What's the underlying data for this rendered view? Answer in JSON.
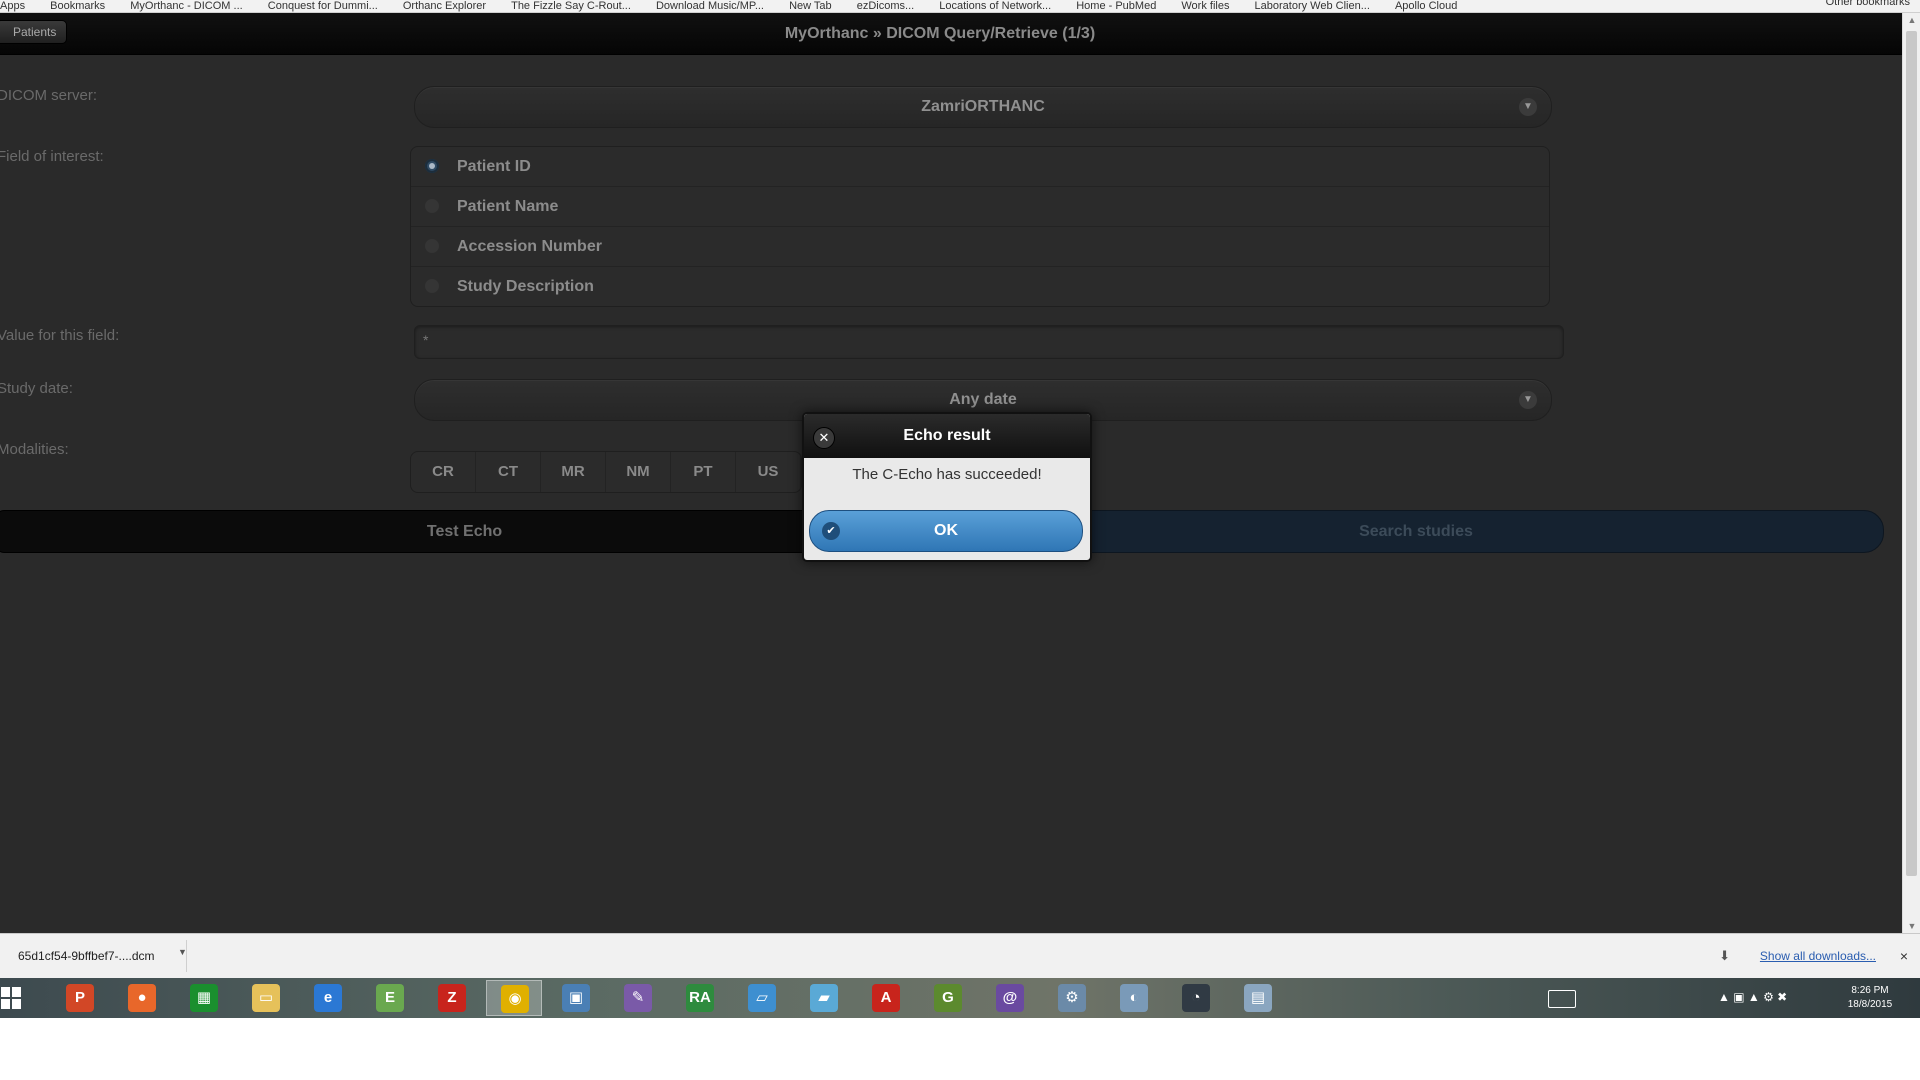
{
  "bookmarks": [
    "Apps",
    "Bookmarks",
    "MyOrthanc - DICOM ...",
    "Conquest for Dummi...",
    "Orthanc Explorer",
    "The Fizzle Say C-Rout...",
    "Download Music/MP...",
    "New Tab",
    "ezDicoms...",
    "Locations of Network...",
    "Home - PubMed",
    "Work files",
    "Laboratory Web Clien...",
    "Apollo Cloud"
  ],
  "bookmarks_other": "Other bookmarks",
  "header": {
    "back_label": "Patients",
    "title": "MyOrthanc » DICOM Query/Retrieve (1/3)"
  },
  "form": {
    "server_label": "DICOM server:",
    "server_value": "ZamriORTHANC",
    "field_label": "Field of interest:",
    "fields": [
      "Patient ID",
      "Patient Name",
      "Accession Number",
      "Study Description"
    ],
    "selected_field": "Patient ID",
    "value_label": "Value for this field:",
    "value": "*",
    "date_label": "Study date:",
    "date_value": "Any date",
    "modalities_label": "Modalities:",
    "modalities": [
      "CR",
      "CT",
      "MR",
      "NM",
      "PT",
      "US"
    ],
    "test_echo": "Test Echo",
    "search_studies": "Search studies"
  },
  "dialog": {
    "title": "Echo result",
    "message": "The C-Echo has succeeded!",
    "ok": "OK"
  },
  "downloads": {
    "file": "65d1cf54-9bffbef7-....dcm",
    "show_all": "Show all downloads...",
    "close": "×"
  },
  "taskbar": {
    "time": "8:26 PM",
    "date": "18/8/2015",
    "apps": [
      {
        "icon": "powerpoint-icon",
        "glyph": "P",
        "color": "#d24726"
      },
      {
        "icon": "firefox-icon",
        "glyph": "●",
        "color": "#e8672a"
      },
      {
        "icon": "project-icon",
        "glyph": "▦",
        "color": "#1a8f2e"
      },
      {
        "icon": "file-explorer-icon",
        "glyph": "▭",
        "color": "#e6c15a"
      },
      {
        "icon": "internet-explorer-icon",
        "glyph": "e",
        "color": "#2b78d4"
      },
      {
        "icon": "evernote-icon",
        "glyph": "E",
        "color": "#6aa84f"
      },
      {
        "icon": "filezilla-icon",
        "glyph": "Z",
        "color": "#c8241c"
      },
      {
        "icon": "chrome-icon",
        "glyph": "◉",
        "color": "#e0b000"
      },
      {
        "icon": "network-tool-icon",
        "glyph": "▣",
        "color": "#4a7fb5"
      },
      {
        "icon": "paint-icon",
        "glyph": "✎",
        "color": "#7a5aa8"
      },
      {
        "icon": "radiant-icon",
        "glyph": "RA",
        "color": "#2e8b3e"
      },
      {
        "icon": "remote-desktop-icon",
        "glyph": "▱",
        "color": "#3e8fd0"
      },
      {
        "icon": "notes-icon",
        "glyph": "▰",
        "color": "#5aa9d6"
      },
      {
        "icon": "acrobat-icon",
        "glyph": "A",
        "color": "#c8241c"
      },
      {
        "icon": "grammarly-icon",
        "glyph": "G",
        "color": "#5c8a2e"
      },
      {
        "icon": "torrent-icon",
        "glyph": "@",
        "color": "#6a4aa0"
      },
      {
        "icon": "settings-icon",
        "glyph": "⚙",
        "color": "#6b8aa8"
      },
      {
        "icon": "paint-palette-icon",
        "glyph": "◐",
        "color": "#7a9ab8"
      },
      {
        "icon": "dicom-viewer-icon",
        "glyph": "◔",
        "color": "#303a44"
      },
      {
        "icon": "documents-icon",
        "glyph": "▤",
        "color": "#8aa6c0"
      }
    ],
    "active_index": 7
  }
}
